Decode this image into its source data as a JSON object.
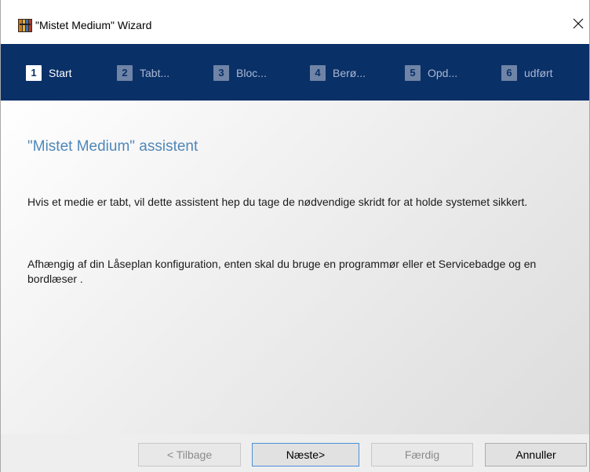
{
  "window": {
    "title": "\"Mistet Medium\" Wizard",
    "app_icon": "wizard-app-icon",
    "close_icon": "close-icon"
  },
  "steps": [
    {
      "number": "1",
      "label": "Start",
      "active": true
    },
    {
      "number": "2",
      "label": "Tabt..."
    },
    {
      "number": "3",
      "label": "Bloc..."
    },
    {
      "number": "4",
      "label": "Berø..."
    },
    {
      "number": "5",
      "label": "Opd..."
    },
    {
      "number": "6",
      "label": "udført"
    }
  ],
  "content": {
    "heading": "\"Mistet Medium\" assistent",
    "paragraph1": "Hvis et medie er tabt, vil dette assistent hep du tage de nødvendige skridt for at holde systemet sikkert.",
    "paragraph2": "Afhængig af din Låseplan konfiguration, enten skal du bruge en programmør eller et Servicebadge og en bordlæser ."
  },
  "buttons": {
    "back": "< Tilbage",
    "next": "Næste>",
    "finish": "Færdig",
    "cancel": "Annuller"
  },
  "colors": {
    "steps_bar": "#0a3068",
    "heading": "#4f87b8",
    "focus_border": "#4a90d9"
  }
}
